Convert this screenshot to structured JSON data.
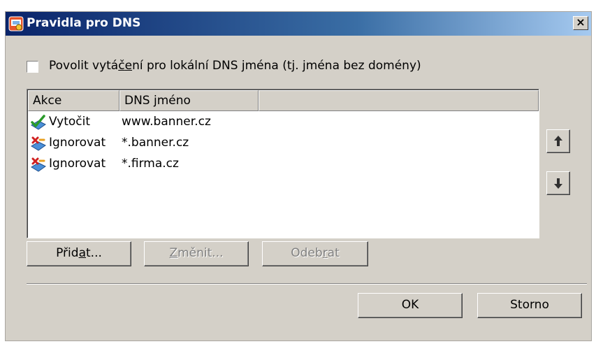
{
  "window": {
    "title": "Pravidla pro DNS",
    "close_glyph": "×"
  },
  "checkbox": {
    "label_pre": "Povolit vytá",
    "label_ul": "č",
    "label_ul2": "e",
    "label_post": "ní pro lokální DNS jména (tj. jména bez domény)",
    "checked": false
  },
  "table": {
    "columns": [
      "Akce",
      "DNS jméno",
      ""
    ],
    "rows": [
      {
        "action": "Vytočit",
        "dns": "www.banner.cz",
        "icon": "dial-check-icon"
      },
      {
        "action": "Ignorovat",
        "dns": "*.banner.cz",
        "icon": "ignore-x-icon"
      },
      {
        "action": "Ignorovat",
        "dns": "*.firma.cz",
        "icon": "ignore-x-icon"
      }
    ]
  },
  "buttons": {
    "add_pre": "Přid",
    "add_ul": "a",
    "add_post": "t...",
    "edit_pre": "",
    "edit_ul": "Z",
    "edit_post": "měnit...",
    "remove_pre": "Odeb",
    "remove_ul": "r",
    "remove_post": "at",
    "ok": "OK",
    "cancel": "Storno"
  },
  "colors": {
    "titlebar_start": "#0a246a",
    "titlebar_end": "#a6caf0",
    "dialog_bg": "#d4d0c8"
  }
}
